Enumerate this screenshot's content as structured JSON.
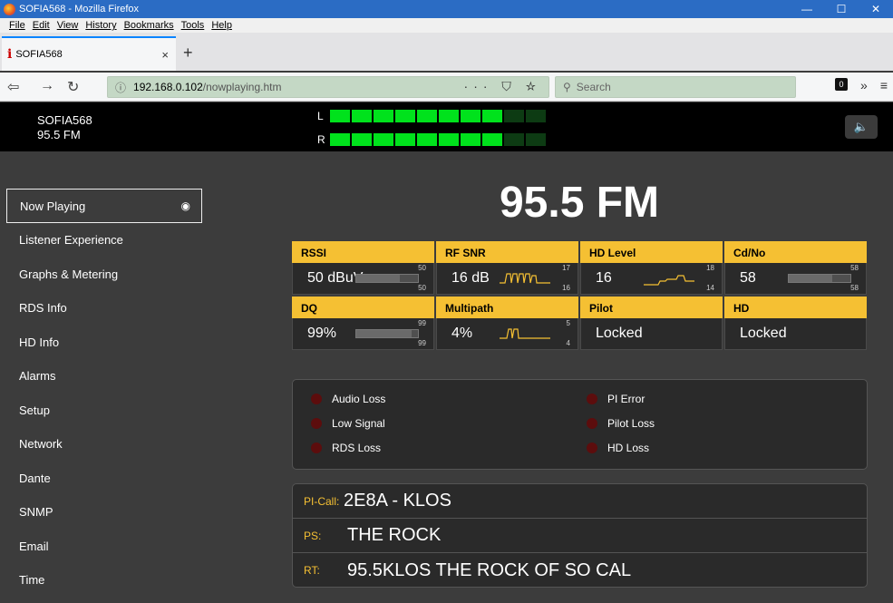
{
  "window": {
    "title": "SOFIA568 - Mozilla Firefox",
    "controls": [
      "minimize-icon",
      "maximize-icon",
      "close-icon"
    ]
  },
  "menu": [
    "File",
    "Edit",
    "View",
    "History",
    "Bookmarks",
    "Tools",
    "Help"
  ],
  "tab": {
    "title": "SOFIA568",
    "close": "×",
    "new": "+"
  },
  "nav": {
    "url_host": "192.168.0.102",
    "url_path": "/nowplaying.htm",
    "actions": "··· ⛉ ☆",
    "search_placeholder": "Search",
    "notif_count": "0",
    "overflow": "»",
    "menu": "≡"
  },
  "header": {
    "station_name": "SOFIA568",
    "station_freq": "95.5 FM",
    "meter_left_label": "L",
    "meter_right_label": "R",
    "meter_left_level": 0.8,
    "meter_right_level": 0.8,
    "speaker_icon": "speaker-icon"
  },
  "sidebar": {
    "items": [
      {
        "label": "Now Playing",
        "active": true
      },
      {
        "label": "Listener Experience"
      },
      {
        "label": "Graphs & Metering"
      },
      {
        "label": "RDS Info"
      },
      {
        "label": "HD Info"
      },
      {
        "label": "Alarms"
      },
      {
        "label": "Setup"
      },
      {
        "label": "Network"
      },
      {
        "label": "Dante"
      },
      {
        "label": "SNMP"
      },
      {
        "label": "Email"
      },
      {
        "label": "Time"
      }
    ]
  },
  "main": {
    "frequency": "95.5 FM",
    "cells": [
      {
        "head": "RSSI",
        "value": "50 dBuV",
        "max": "50",
        "min": "50",
        "kind": "bar",
        "level": 0.7
      },
      {
        "head": "RF SNR",
        "value": "16 dB",
        "max": "17",
        "min": "16",
        "kind": "wave"
      },
      {
        "head": "HD Level",
        "value": "16",
        "max": "18",
        "min": "14",
        "kind": "step"
      },
      {
        "head": "Cd/No",
        "value": "58",
        "max": "58",
        "min": "58",
        "kind": "bar",
        "level": 0.7
      },
      {
        "head": "DQ",
        "value": "99%",
        "max": "99",
        "min": "99",
        "kind": "bar",
        "level": 0.9
      },
      {
        "head": "Multipath",
        "value": "4%",
        "max": "5",
        "min": "4",
        "kind": "pulse"
      },
      {
        "head": "Pilot",
        "value": "Locked",
        "max": "",
        "min": "",
        "kind": "none"
      },
      {
        "head": "HD",
        "value": "Locked",
        "max": "",
        "min": "",
        "kind": "none"
      }
    ],
    "alarms": [
      {
        "label": "Audio Loss"
      },
      {
        "label": "Low Signal"
      },
      {
        "label": "RDS Loss"
      },
      {
        "label": "PI Error"
      },
      {
        "label": "Pilot Loss"
      },
      {
        "label": "HD Loss"
      }
    ],
    "rds": [
      {
        "label": "PI-Call:",
        "value": "2E8A - KLOS"
      },
      {
        "label": "PS:",
        "value": "THE ROCK"
      },
      {
        "label": "RT:",
        "value": "95.5KLOS THE ROCK OF SO CAL"
      }
    ]
  },
  "colors": {
    "accent": "#f5c033",
    "meter_on": "#00e21c",
    "meter_off": "#0d3b13",
    "led_off": "#5c0d0d"
  }
}
